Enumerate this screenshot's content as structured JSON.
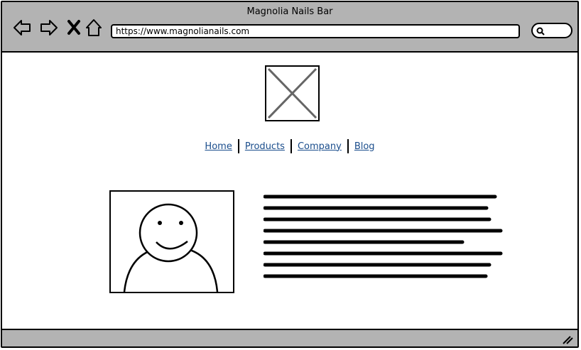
{
  "window": {
    "title": "Magnolia Nails Bar"
  },
  "toolbar": {
    "url": "https://www.magnolianails.com",
    "back_icon": "back-arrow-icon",
    "forward_icon": "forward-arrow-icon",
    "close_icon": "close-x-icon",
    "home_icon": "home-icon",
    "search_icon": "search-icon"
  },
  "nav": {
    "items": [
      {
        "label": "Home"
      },
      {
        "label": "Products"
      },
      {
        "label": "Company"
      },
      {
        "label": "Blog"
      }
    ]
  },
  "colors": {
    "chrome": "#b3b3b3",
    "link": "#1a4d8c",
    "border": "#000000"
  }
}
